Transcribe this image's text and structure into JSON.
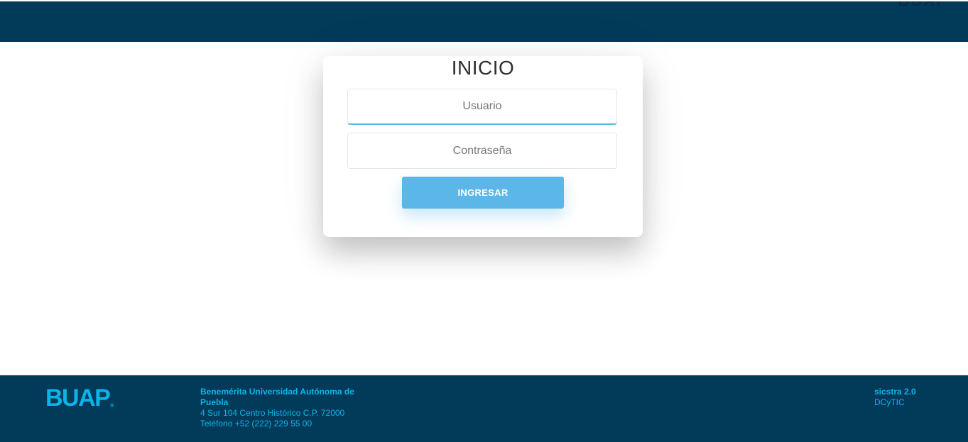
{
  "header": {
    "logo_fragment": "BUAP"
  },
  "login": {
    "title": "INICIO",
    "username_placeholder": "Usuario",
    "password_placeholder": "Contraseña",
    "submit_label": "INGRESAR"
  },
  "footer": {
    "logo_text": "BUAP",
    "logo_mark": "®",
    "organization": "Benemérita Universidad Autónoma de Puebla",
    "address": "4 Sur 104 Centro Histórico C.P. 72000",
    "phone": "Teléfono +52 (222) 229 55 00",
    "app_name": "sicstra 2.0",
    "department": "DCyTIC"
  },
  "colors": {
    "header_bg": "#023a5a",
    "accent": "#5bb7e8",
    "footer_text": "#0ab4e8"
  }
}
